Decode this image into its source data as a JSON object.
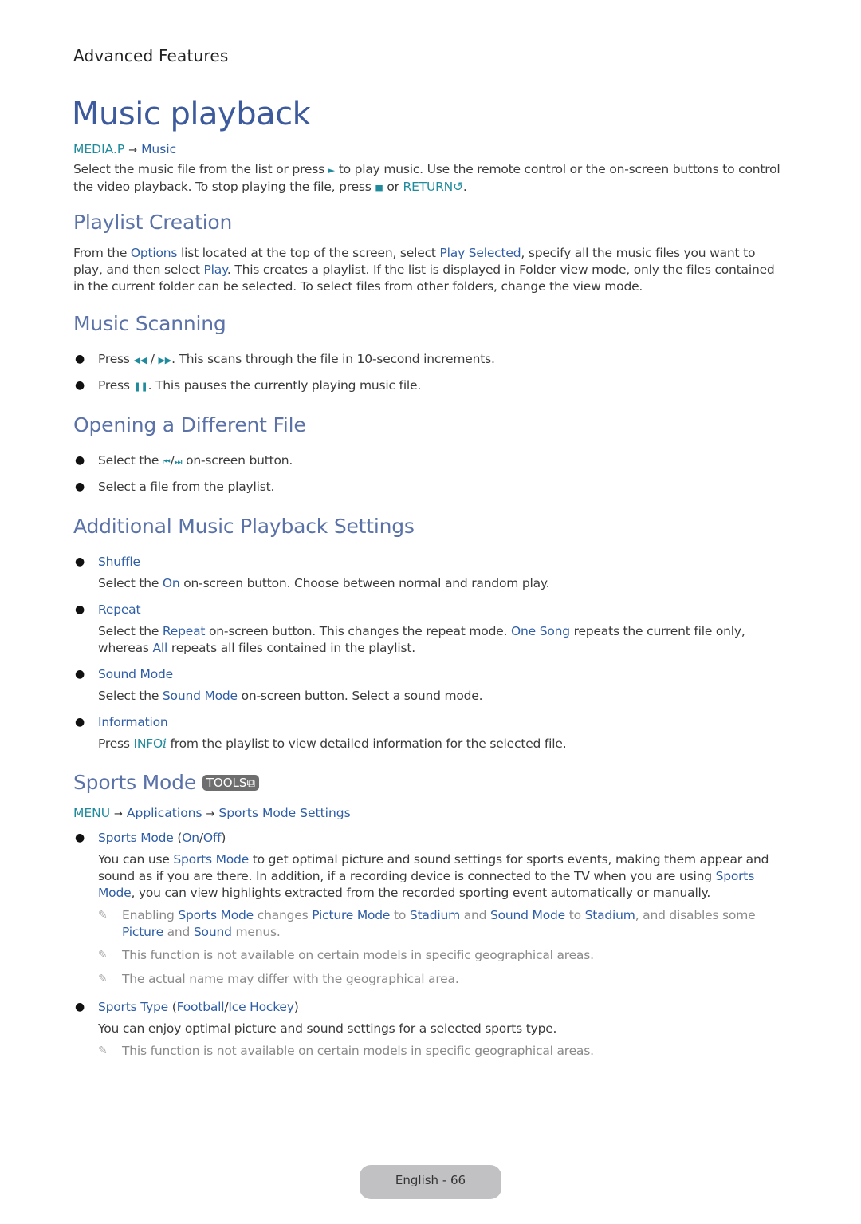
{
  "chapter": "Advanced Features",
  "title": "Music playback",
  "intro": {
    "path": [
      "MEDIA.P",
      "Music"
    ],
    "text": {
      "a": "Select the music file from the list or press ",
      "play_icon": "►",
      "b": " to play music. Use the remote control or the on-screen buttons to control the video playback. To stop playing the file, press ",
      "stop_icon": "■",
      "c": " or ",
      "return": "RETURN",
      "return_icon": "↺",
      "d": "."
    }
  },
  "sections": {
    "playlist": {
      "heading": "Playlist Creation",
      "t1": "From the ",
      "k1": "Options",
      "t2": " list located at the top of the screen, select ",
      "k2": "Play Selected",
      "t3": ", specify all the music files you want to play, and then select ",
      "k3": "Play",
      "t4": ". This creates a playlist. If the list is displayed in Folder view mode, only the files contained in the current folder can be selected. To select files from other folders, change the view mode."
    },
    "scanning": {
      "heading": "Music Scanning",
      "b1": {
        "a": "Press ",
        "rew": "◀◀",
        "sep": " / ",
        "ff": "▶▶",
        "b": ". This scans through the file in 10-second increments."
      },
      "b2": {
        "a": "Press ",
        "pause": "❚❚",
        "b": ". This pauses the currently playing music file."
      }
    },
    "opening": {
      "heading": "Opening a Different File",
      "b1": {
        "a": "Select the ",
        "prev": "⏮",
        "sep": "/",
        "next": "⏭",
        "b": " on-screen button."
      },
      "b2": "Select a file from the playlist."
    },
    "additional": {
      "heading": "Additional Music Playback Settings",
      "shuffle": {
        "label": "Shuffle",
        "a": "Select the ",
        "k": "On",
        "b": " on-screen button. Choose between normal and random play."
      },
      "repeat": {
        "label": "Repeat",
        "a": "Select the ",
        "k1": "Repeat",
        "b": " on-screen button. This changes the repeat mode. ",
        "k2": "One Song",
        "c": " repeats the current file only, whereas ",
        "k3": "All",
        "d": " repeats all files contained in the playlist."
      },
      "sound": {
        "label": "Sound Mode",
        "a": "Select the ",
        "k": "Sound Mode",
        "b": " on-screen button. Select a sound mode."
      },
      "info": {
        "label": "Information",
        "a": "Press ",
        "k": "INFO",
        "icon": "i",
        "b": " from the playlist to view detailed information for the selected file."
      }
    },
    "sports": {
      "heading": "Sports Mode",
      "badge": "TOOLS",
      "badge_icon": "⧉",
      "path": [
        "MENU",
        "Applications",
        "Sports Mode Settings"
      ],
      "mode": {
        "label": "Sports Mode",
        "opt_on": "On",
        "opt_off": "Off",
        "a": "You can use ",
        "k1": "Sports Mode",
        "b": " to get optimal picture and sound settings for sports events, making them appear and sound as if you are there. In addition, if a recording device is connected to the TV when you are using ",
        "k2": "Sports Mode",
        "c": ", you can view highlights extracted from the recorded sporting event automatically or manually."
      },
      "note1": {
        "a": "Enabling ",
        "k1": "Sports Mode",
        "b": " changes ",
        "k2": "Picture Mode",
        "c": " to ",
        "k3": "Stadium",
        "d": " and ",
        "k4": "Sound Mode",
        "e": " to ",
        "k5": "Stadium",
        "f": ", and disables some ",
        "k6": "Picture",
        "g": " and ",
        "k7": "Sound",
        "h": " menus."
      },
      "note2": "This function is not available on certain models in specific geographical areas.",
      "note3": "The actual name may differ with the geographical area.",
      "type": {
        "label": "Sports Type",
        "opt1": "Football",
        "opt2": "Ice Hockey",
        "text": "You can enjoy optimal picture and sound settings for a selected sports type.",
        "note": "This function is not available on certain models in specific geographical areas."
      }
    }
  },
  "footer": "English - 66",
  "icons": {
    "bullet": "●",
    "pen": "✎",
    "arrow": "→"
  }
}
